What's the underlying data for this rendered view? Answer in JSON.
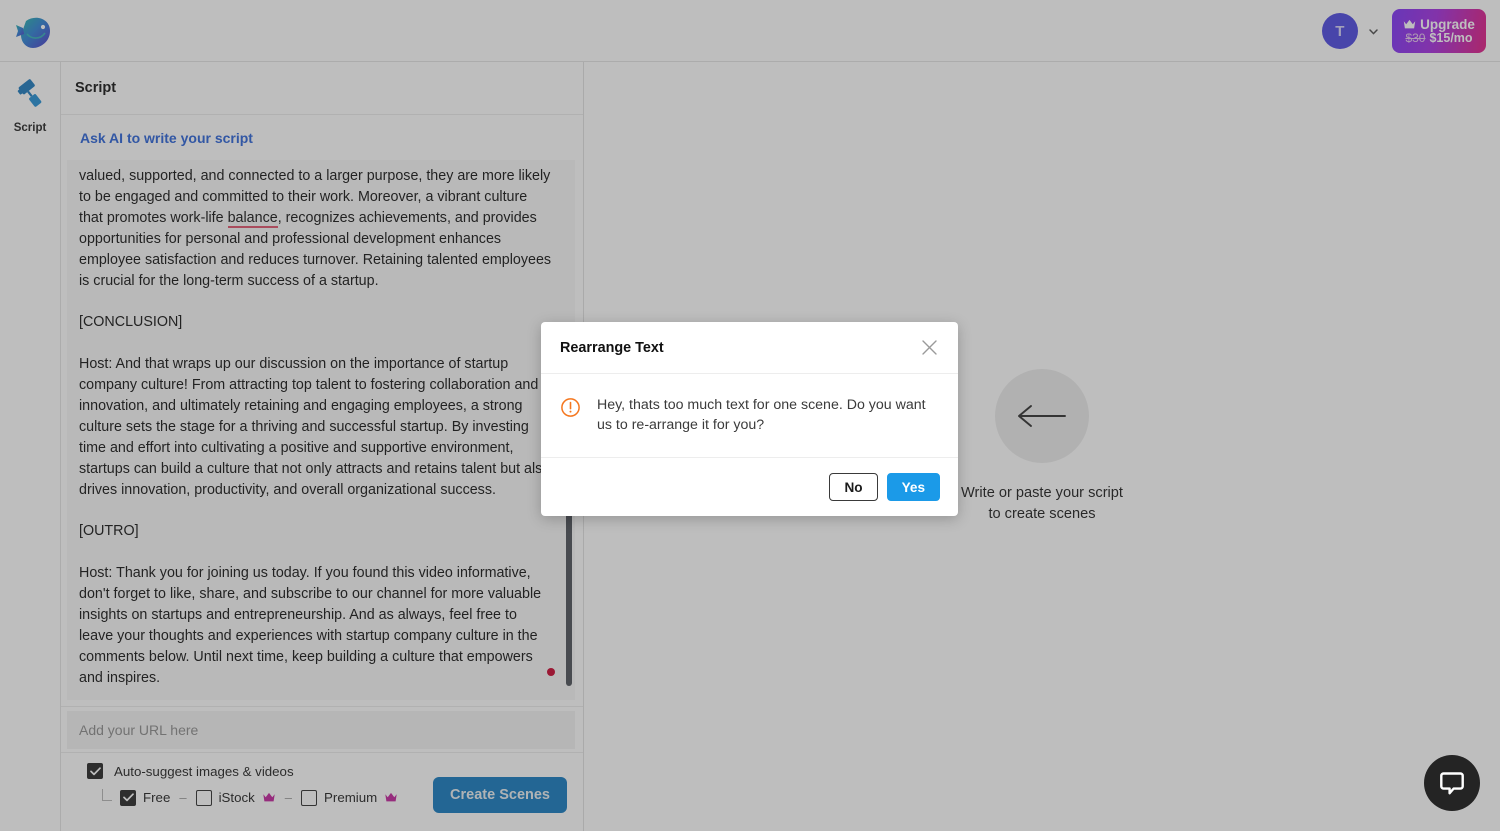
{
  "topbar": {
    "logo_icon": "fish-logo-icon",
    "avatar_initial": "T",
    "avatar_chevron_icon": "chevron-down-icon",
    "upgrade": {
      "crown_icon": "crown-icon",
      "label": "Upgrade",
      "price_old": "$30",
      "price_new": "$15/mo"
    }
  },
  "rail": {
    "items": [
      {
        "icon": "script-roller-icon",
        "label": "Script"
      }
    ]
  },
  "script_panel": {
    "header_title": "Script",
    "ask_ai_label": "Ask AI to write your script",
    "script_text_before": "valued, supported, and connected to a larger purpose, they are more likely to be engaged and committed to their work. Moreover, a vibrant culture that promotes work-life ",
    "script_misspelled_word": "balance",
    "script_text_after": ", recognizes achievements, and provides opportunities for personal and professional development enhances employee satisfaction and reduces turnover. Retaining talented employees is crucial for the long-term success of a startup.\n\n[CONCLUSION]\n\nHost: And that wraps up our discussion on the importance of startup company culture! From attracting top talent to fostering collaboration and innovation, and ultimately retaining and engaging employees, a strong culture sets the stage for a thriving and successful startup. By investing time and effort into cultivating a positive and supportive environment, startups can build a culture that not only attracts and retains talent but also drives innovation, productivity, and overall organizational success.\n\n[OUTRO]\n\nHost: Thank you for joining us today. If you found this video informative, don't forget to like, share, and subscribe to our channel for more valuable insights on startups and entrepreneurship. And as always, feel free to leave your thoughts and experiences with startup company culture in the comments below. Until next time, keep building a culture that empowers and inspires.",
    "url_placeholder": "Add your URL here",
    "url_value": "",
    "options": {
      "auto_suggest_label": "Auto-suggest images & videos",
      "auto_suggest_checked": true,
      "sources": [
        {
          "label": "Free",
          "checked": true,
          "crown": false
        },
        {
          "label": "iStock",
          "checked": false,
          "crown": true
        },
        {
          "label": "Premium",
          "checked": false,
          "crown": true
        }
      ],
      "separator": "–"
    },
    "create_scenes_label": "Create Scenes"
  },
  "stage": {
    "arrow_icon": "arrow-left-icon",
    "line1": "Write or paste your script",
    "line2": "to create scenes"
  },
  "chat": {
    "icon": "chat-bubble-icon"
  },
  "modal": {
    "title": "Rearrange Text",
    "close_icon": "close-icon",
    "alert_icon": "alert-circle-icon",
    "message": "Hey, thats too much text for one scene. Do you want us to re-arrange it for you?",
    "no_label": "No",
    "yes_label": "Yes"
  },
  "colors": {
    "accent_blue": "#1b9ae8",
    "create_button_blue": "#1179bf",
    "link_blue": "#2962d8",
    "alert_orange": "#f5771f",
    "crown_magenta": "#c2209b",
    "avatar_purple": "#4b45e0",
    "spellcheck_red": "#e0506a",
    "caret_dot_red": "#c9002b"
  }
}
